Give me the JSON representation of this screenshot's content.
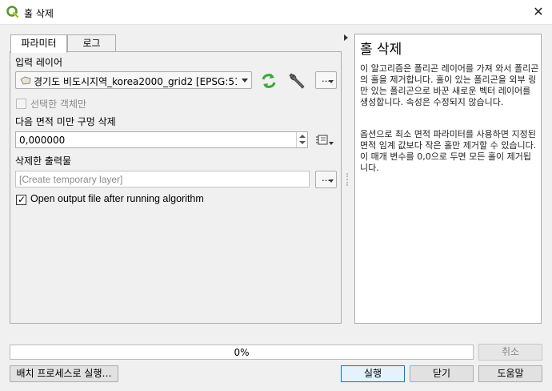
{
  "window": {
    "title": "홀 삭제"
  },
  "tabs": [
    {
      "label": "파라미터"
    },
    {
      "label": "로그"
    }
  ],
  "params": {
    "input_layer_label": "입력 레이어",
    "input_layer_value": "경기도 비도시지역_korea2000_grid2 [EPSG:51",
    "selected_only_label": "선택한 객체만",
    "selected_only_checked": false,
    "min_area_label": "다음 면적 미만 구멍 삭제",
    "min_area_value": "0,000000",
    "output_label": "삭제한 출력물",
    "output_placeholder": "[Create temporary layer]",
    "open_output_label": "Open output file after running algorithm",
    "open_output_checked": true,
    "dots": "…"
  },
  "help": {
    "title": "홀 삭제",
    "paragraph1": "이 알고리즘은 폴리곤 레이어를 가져 와서 폴리곤의 홀을 제거합니다. 홀이 있는 폴리곤을 외부 링만 있는 폴리곤으로 바꾼 새로운 벡터 레이어를 생성합니다. 속성은 수정되지 않습니다.",
    "paragraph2": "옵션으로 최소 면적 파라미터를 사용하면 지정된 면적 임계 값보다 작은 홀만 제거할 수 있습니다. 이 매개 변수를 0,0으로 두면 모든 홀이 제거됩니다."
  },
  "progress": {
    "text": "0%",
    "value": 0
  },
  "buttons": {
    "cancel": "취소",
    "batch": "배치 프로세스로 실행…",
    "run": "실행",
    "close": "닫기",
    "help": "도움말"
  },
  "colors": {
    "qgis_green": "#589632",
    "qgis_yellow": "#f0e64a",
    "refresh_green": "#3aa83a",
    "accent_blue": "#0078d7"
  }
}
